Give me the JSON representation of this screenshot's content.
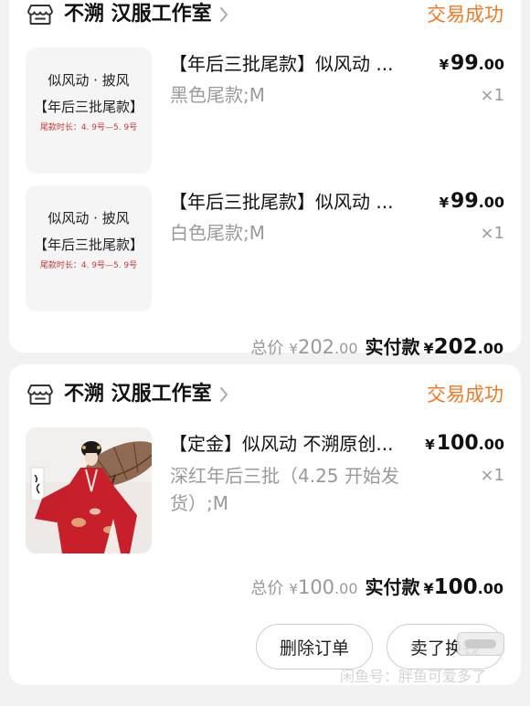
{
  "orders": [
    {
      "shop_name": "不溯 汉服工作室",
      "status": "交易成功",
      "items": [
        {
          "thumb_caption": {
            "line1": "似风动 · 披风",
            "line2": "【年后三批尾款】",
            "line3": "尾款时长：4. 9号—5. 9号"
          },
          "title": "【年后三批尾款】似风动 ...",
          "price": {
            "symbol": "¥",
            "int": "99",
            "dec": ".00"
          },
          "sku": "黑色尾款;M",
          "qty": "×1"
        },
        {
          "thumb_caption": {
            "line1": "似风动 · 披风",
            "line2": "【年后三批尾款】",
            "line3": "尾款时长：4. 9号—5. 9号"
          },
          "title": "【年后三批尾款】似风动 ...",
          "price": {
            "symbol": "¥",
            "int": "99",
            "dec": ".00"
          },
          "sku": "白色尾款;M",
          "qty": "×1"
        }
      ],
      "total": {
        "label": "总价",
        "symbol": "¥",
        "int": "202",
        "dec": ".00"
      },
      "paid": {
        "label": "实付款",
        "symbol": "¥",
        "int": "202",
        "dec": ".00"
      }
    },
    {
      "shop_name": "不溯 汉服工作室",
      "status": "交易成功",
      "items": [
        {
          "title": "【定金】似风动 不溯原创...",
          "price": {
            "symbol": "¥",
            "int": "100",
            "dec": ".00"
          },
          "sku": "深红年后三批（4.25 开始发货）;M",
          "qty": "×1"
        }
      ],
      "total": {
        "label": "总价",
        "symbol": "¥",
        "int": "100",
        "dec": ".00"
      },
      "paid": {
        "label": "实付款",
        "symbol": "¥",
        "int": "100",
        "dec": ".00"
      },
      "actions": {
        "delete": "删除订单",
        "sell": "卖了换钱"
      }
    }
  ],
  "watermark": "闲鱼号：胖鱼可爱多了",
  "icons": {
    "store": "store-icon",
    "chevron": "chevron-right-icon"
  },
  "colors": {
    "status": "#f27a24",
    "caption_red": "#c23a3a",
    "muted": "#999999",
    "background": "#f2f2f2"
  }
}
